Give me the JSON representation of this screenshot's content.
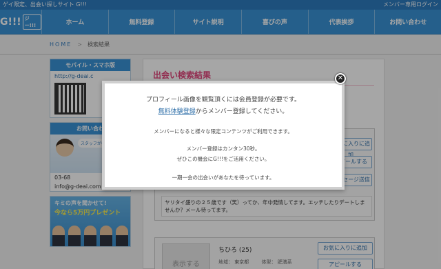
{
  "topbar": {
    "tagline": "ゲイ限定、出会い探しサイト G!!!",
    "member_login": "メンバー専用ログイン"
  },
  "logo": {
    "text": "G!!!",
    "badge": "ジー!!!"
  },
  "nav": [
    "ホーム",
    "無料登録",
    "サイト説明",
    "喜びの声",
    "代表挨拶",
    "お問い合わせ"
  ],
  "breadcrumb": {
    "home": "HOME",
    "sep": ">",
    "current": "検索結果"
  },
  "sidebar": {
    "mobile_title": "モバイル・スマホ版",
    "mobile_url": "http://g-deai.c",
    "contact_title": "お問い合わ",
    "contact_bubble": "スタッフが相談の",
    "contact_phone": "03-68",
    "contact_email": "info@g-deai.com",
    "promo_line1": "キミの声を聞かせて!",
    "promo_line2": "今なら5万円プレゼント"
  },
  "main": {
    "title": "出会い検索結果",
    "card1_buttons": [
      "お気に入りに追加",
      "アピールする",
      "メッセージ送信"
    ],
    "card1_message": "ヤリタイ盛りの２５歳です（笑）ってか、年中発情してます。エッチしたりデートしませんか？メール待ってます。",
    "card2_name": "ちひろ (25)",
    "card2_area_label": "地域：",
    "card2_area": "東京都",
    "card2_body_label": "体型：",
    "card2_body": "肥満系",
    "card2_buttons": [
      "お気に入りに追加",
      "アピールする"
    ],
    "avatar_text": "表示する"
  },
  "modal": {
    "line1": "プロフィール画像を観覧頂くには会員登録が必要です。",
    "line2_link": "無料体験登録",
    "line2_rest": "からメンバー登録してください。",
    "line3": "メンバーになると様々な限定コンテンツがご利用できます。",
    "line4": "メンバー登録はカンタン30秒。",
    "line5": "ぜひこの機会にG!!!をご活用ください。",
    "line6": "一期一会の出会いがあなたを待っています。",
    "close_glyph": "✕"
  }
}
